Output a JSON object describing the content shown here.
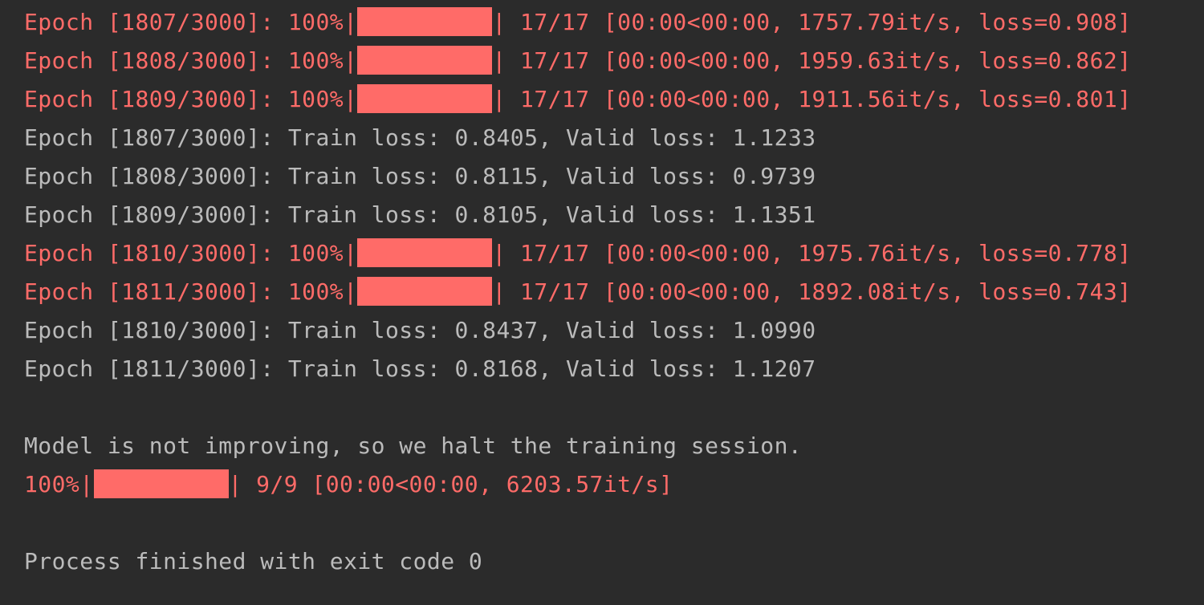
{
  "colors": {
    "background": "#2b2b2b",
    "stderr_text": "#ff6b68",
    "stdout_text": "#bbbbbb"
  },
  "lines": [
    {
      "kind": "progress",
      "before": "Epoch [1807/3000]: 100%|",
      "after": "| 17/17 [00:00<00:00, 1757.79it/s, loss=0.908]",
      "fill": 1.0
    },
    {
      "kind": "progress",
      "before": "Epoch [1808/3000]: 100%|",
      "after": "| 17/17 [00:00<00:00, 1959.63it/s, loss=0.862]",
      "fill": 1.0
    },
    {
      "kind": "progress",
      "before": "Epoch [1809/3000]: 100%|",
      "after": "| 17/17 [00:00<00:00, 1911.56it/s, loss=0.801]",
      "fill": 1.0
    },
    {
      "kind": "output",
      "text": "Epoch [1807/3000]: Train loss: 0.8405, Valid loss: 1.1233"
    },
    {
      "kind": "output",
      "text": "Epoch [1808/3000]: Train loss: 0.8115, Valid loss: 0.9739"
    },
    {
      "kind": "output",
      "text": "Epoch [1809/3000]: Train loss: 0.8105, Valid loss: 1.1351"
    },
    {
      "kind": "progress",
      "before": "Epoch [1810/3000]: 100%|",
      "after": "| 17/17 [00:00<00:00, 1975.76it/s, loss=0.778]",
      "fill": 1.0
    },
    {
      "kind": "progress",
      "before": "Epoch [1811/3000]: 100%|",
      "after": "| 17/17 [00:00<00:00, 1892.08it/s, loss=0.743]",
      "fill": 1.0
    },
    {
      "kind": "output",
      "text": "Epoch [1810/3000]: Train loss: 0.8437, Valid loss: 1.0990"
    },
    {
      "kind": "output",
      "text": "Epoch [1811/3000]: Train loss: 0.8168, Valid loss: 1.1207"
    },
    {
      "kind": "blank"
    },
    {
      "kind": "output",
      "text": "Model is not improving, so we halt the training session."
    },
    {
      "kind": "progress",
      "before": "100%|",
      "after": "| 9/9 [00:00<00:00, 6203.57it/s]",
      "fill": 1.0
    },
    {
      "kind": "blank"
    },
    {
      "kind": "output",
      "text": "Process finished with exit code 0"
    }
  ]
}
